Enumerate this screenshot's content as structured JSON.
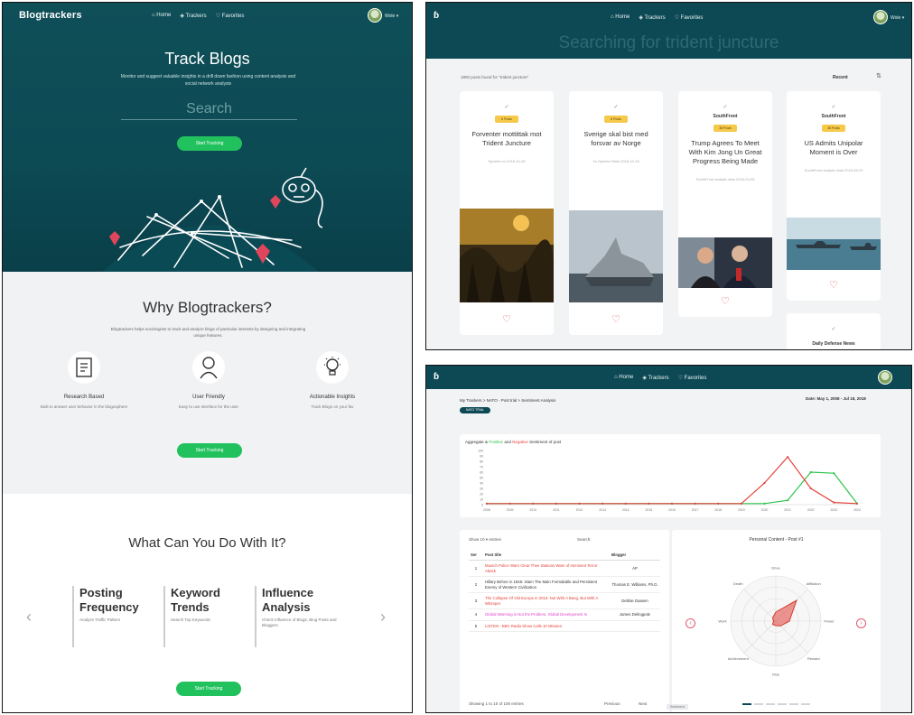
{
  "landing": {
    "brand": "Blogtrackers",
    "nav": [
      "Home",
      "Trackers",
      "Favorites"
    ],
    "user": "Wole",
    "hero_title": "Track Blogs",
    "hero_subtitle": "Monitor and suggest valuable insights in a drill down fashion using content analysis and social network analysis",
    "search_placeholder": "Search",
    "cta": "Start Tracking",
    "why_title": "Why Blogtrackers?",
    "why_subtitle": "Blogtrackers helps sociologists to track and analyze blogs of particular interests by designing and integrating unique features.",
    "features": [
      {
        "title": "Research Based",
        "desc": "Built to answer user behavior in the blogosphere"
      },
      {
        "title": "User Friendly",
        "desc": "Easy to use interface for the user"
      },
      {
        "title": "Actionable Insights",
        "desc": "Track Blogs on your fav"
      }
    ],
    "what_title": "What Can You Do With It?",
    "cards": [
      {
        "title": "Posting Frequency",
        "desc": "Analyze Traffic Pattern"
      },
      {
        "title": "Keyword Trends",
        "desc": "Search Top Keywords"
      },
      {
        "title": "Influence Analysis",
        "desc": "Check Influence of Blogs, Blog Posts and Bloggers"
      }
    ]
  },
  "search": {
    "nav": [
      "Home",
      "Trackers",
      "Favorites"
    ],
    "user": "Wole",
    "heading": "Searching for trident juncture",
    "result_count": "1800 posts found for \"trident juncture\"",
    "sort_label": "Recent",
    "results": [
      {
        "source": "",
        "badge": "6 Posts",
        "title": "Forventer mottittak mot Trident Juncture",
        "meta": "Nyheter.no 2018-10-28",
        "favorited": false
      },
      {
        "source": "",
        "badge": "6 Posts",
        "title": "Sverige skal bist med forsvar av Norge",
        "meta": "Vs Nyheter Blast 2018-10-18",
        "favorited": false
      },
      {
        "source": "SouthFront",
        "badge": "38 Posts",
        "title": "Trump Agrees To Meet With Kim Jong Un Great Progress Being Made",
        "meta": "SouthFront analytic data 2018-03-08",
        "favorited": false
      },
      {
        "source": "SouthFront",
        "badge": "38 Posts",
        "title": "US Admits Unipolar Moment is Over",
        "meta": "SouthFront analytic data 2018-08-20",
        "favorited": false
      },
      {
        "source": "Daily Defense News",
        "badge": "",
        "title": "",
        "meta": "",
        "favorited": false
      }
    ]
  },
  "sentiment": {
    "nav": [
      "Home",
      "Trackers",
      "Favorites"
    ],
    "breadcrumb": "My Trackers > NATO - Post trial > Sentiment Analysis",
    "date_range": "Date: May 1, 2008 - Jul 18, 2018",
    "pill": "NATO TRIAL",
    "legend": {
      "prefix": "Aggregate",
      "positive": "Positive",
      "mid": "and",
      "negative": "Negative",
      "suffix": "Sentiment of post"
    },
    "chart_data": {
      "type": "line",
      "title": "",
      "x": [
        "2008",
        "2009",
        "2010",
        "2011",
        "2012",
        "2013",
        "2014",
        "2015",
        "2016",
        "2017",
        "2018",
        "2019",
        "2020",
        "2021",
        "2022",
        "2023",
        "2024"
      ],
      "ylim": [
        0,
        100
      ],
      "series": [
        {
          "name": "Positive",
          "color": "#2cc44a",
          "values": [
            2,
            2,
            2,
            2,
            2,
            2,
            2,
            2,
            2,
            2,
            2,
            2,
            2,
            8,
            60,
            58,
            2
          ]
        },
        {
          "name": "Negative",
          "color": "#e2433a",
          "values": [
            2,
            2,
            2,
            2,
            2,
            2,
            2,
            2,
            2,
            2,
            2,
            2,
            40,
            88,
            30,
            4,
            2
          ]
        }
      ]
    },
    "table": {
      "show_label": "Show",
      "entries_value": "10",
      "entries_label": "entries",
      "search_label": "Search:",
      "headers": [
        "Ser",
        "Post title",
        "Blogger"
      ],
      "rows": [
        {
          "num": "1",
          "title": "Munich Police Warn Clear Thee Stations Warn of Imminent Terror Attack",
          "blogger": "AP",
          "tone": "red"
        },
        {
          "num": "2",
          "title": "Hillary Before in 1945: Islam The Main Formidable and Persistent Enemy of Western Civilization",
          "blogger": "Thomas E. Williams, Ph.D.",
          "tone": "dark"
        },
        {
          "num": "3",
          "title": "The Collapse Of Old Europe in 2016: Not With A Bang, But With A Whimper",
          "blogger": "Debbie Daasen",
          "tone": "red"
        },
        {
          "num": "4",
          "title": "Global Warming is Not the Problem, Global Development Is",
          "blogger": "James Delingpole",
          "tone": "pink"
        },
        {
          "num": "5",
          "title": "LISTEN - BBC Radio Show Calls 10 Minutes",
          "blogger": "",
          "tone": "red"
        }
      ],
      "info": "Showing 1 to 10 of 100 entries",
      "prev": "Previous",
      "next": "Next"
    },
    "radar": {
      "title": "Personal Content - Post #1",
      "axes": [
        "Drive",
        "Affiliation",
        "Power",
        "Reward",
        "Risk",
        "Achievement",
        "Work",
        "Death"
      ],
      "values": [
        0.2,
        0.65,
        0.3,
        0.15,
        0.1,
        0.1,
        0.05,
        0.1
      ]
    },
    "tab_footer": "Sentiment"
  }
}
